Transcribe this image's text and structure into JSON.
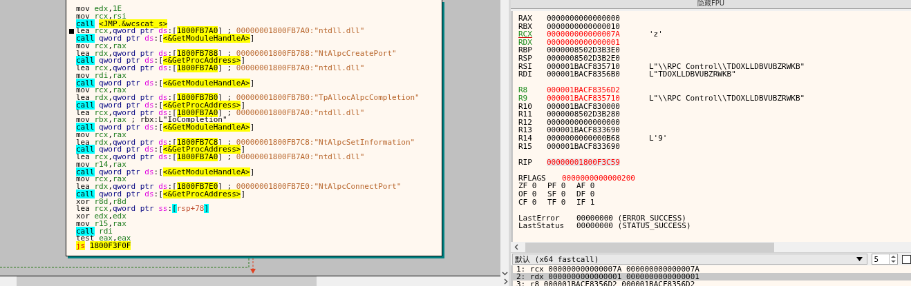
{
  "disassembly": {
    "lines": [
      {
        "marker": false,
        "tokens": [
          {
            "kind": "op",
            "text": "mov "
          },
          {
            "kind": "reg",
            "text": "edx"
          },
          {
            "kind": "punct",
            "text": ","
          },
          {
            "kind": "num",
            "text": "1E"
          }
        ]
      },
      {
        "marker": false,
        "tokens": [
          {
            "kind": "op",
            "text": "mov "
          },
          {
            "kind": "reg",
            "text": "rcx"
          },
          {
            "kind": "punct",
            "text": ","
          },
          {
            "kind": "reg",
            "text": "rsi"
          }
        ]
      },
      {
        "marker": false,
        "tokens": [
          {
            "kind": "call",
            "text": "call"
          },
          {
            "kind": "sym",
            "text": "<JMP.&wcscat_s>"
          }
        ]
      },
      {
        "marker": true,
        "tokens": [
          {
            "kind": "op",
            "text": "lea "
          },
          {
            "kind": "reg",
            "text": "rcx"
          },
          {
            "kind": "punct",
            "text": ","
          },
          {
            "kind": "kw",
            "text": "qword ptr "
          },
          {
            "kind": "seg",
            "text": "ds"
          },
          {
            "kind": "punct",
            "text": ":["
          },
          {
            "kind": "addr",
            "text": "1800FB7A0"
          },
          {
            "kind": "punct",
            "text": "] ; "
          },
          {
            "kind": "comment",
            "text": "00000001800FB7A0:\"ntdll.dll\""
          }
        ]
      },
      {
        "marker": false,
        "tokens": [
          {
            "kind": "call",
            "text": "call"
          },
          {
            "kind": "kw",
            "text": "qword ptr "
          },
          {
            "kind": "seg",
            "text": "ds"
          },
          {
            "kind": "punct",
            "text": ":["
          },
          {
            "kind": "sym",
            "text": "<&GetModuleHandleA>"
          },
          {
            "kind": "punct",
            "text": "]"
          }
        ]
      },
      {
        "marker": false,
        "tokens": [
          {
            "kind": "op",
            "text": "mov "
          },
          {
            "kind": "reg",
            "text": "rcx"
          },
          {
            "kind": "punct",
            "text": ","
          },
          {
            "kind": "reg",
            "text": "rax"
          }
        ]
      },
      {
        "marker": false,
        "tokens": [
          {
            "kind": "op",
            "text": "lea "
          },
          {
            "kind": "reg",
            "text": "rdx"
          },
          {
            "kind": "punct",
            "text": ","
          },
          {
            "kind": "kw",
            "text": "qword ptr "
          },
          {
            "kind": "seg",
            "text": "ds"
          },
          {
            "kind": "punct",
            "text": ":["
          },
          {
            "kind": "addr",
            "text": "1800FB788"
          },
          {
            "kind": "punct",
            "text": "] ; "
          },
          {
            "kind": "comment",
            "text": "00000001800FB788:\"NtAlpcCreatePort\""
          }
        ]
      },
      {
        "marker": false,
        "tokens": [
          {
            "kind": "call",
            "text": "call"
          },
          {
            "kind": "kw",
            "text": "qword ptr "
          },
          {
            "kind": "seg",
            "text": "ds"
          },
          {
            "kind": "punct",
            "text": ":["
          },
          {
            "kind": "sym",
            "text": "<&GetProcAddress>"
          },
          {
            "kind": "punct",
            "text": "]"
          }
        ]
      },
      {
        "marker": false,
        "tokens": [
          {
            "kind": "op",
            "text": "lea "
          },
          {
            "kind": "reg",
            "text": "rcx"
          },
          {
            "kind": "punct",
            "text": ","
          },
          {
            "kind": "kw",
            "text": "qword ptr "
          },
          {
            "kind": "seg",
            "text": "ds"
          },
          {
            "kind": "punct",
            "text": ":["
          },
          {
            "kind": "addr",
            "text": "1800FB7A0"
          },
          {
            "kind": "punct",
            "text": "] ; "
          },
          {
            "kind": "comment",
            "text": "00000001800FB7A0:\"ntdll.dll\""
          }
        ]
      },
      {
        "marker": false,
        "tokens": [
          {
            "kind": "op",
            "text": "mov "
          },
          {
            "kind": "reg",
            "text": "rdi"
          },
          {
            "kind": "punct",
            "text": ","
          },
          {
            "kind": "reg",
            "text": "rax"
          }
        ]
      },
      {
        "marker": false,
        "tokens": [
          {
            "kind": "call",
            "text": "call"
          },
          {
            "kind": "kw",
            "text": "qword ptr "
          },
          {
            "kind": "seg",
            "text": "ds"
          },
          {
            "kind": "punct",
            "text": ":["
          },
          {
            "kind": "sym",
            "text": "<&GetModuleHandleA>"
          },
          {
            "kind": "punct",
            "text": "]"
          }
        ]
      },
      {
        "marker": false,
        "tokens": [
          {
            "kind": "op",
            "text": "mov "
          },
          {
            "kind": "reg",
            "text": "rcx"
          },
          {
            "kind": "punct",
            "text": ","
          },
          {
            "kind": "reg",
            "text": "rax"
          }
        ]
      },
      {
        "marker": false,
        "tokens": [
          {
            "kind": "op",
            "text": "lea "
          },
          {
            "kind": "reg",
            "text": "rdx"
          },
          {
            "kind": "punct",
            "text": ","
          },
          {
            "kind": "kw",
            "text": "qword ptr "
          },
          {
            "kind": "seg",
            "text": "ds"
          },
          {
            "kind": "punct",
            "text": ":["
          },
          {
            "kind": "addr",
            "text": "1800FB7B0"
          },
          {
            "kind": "punct",
            "text": "] ; "
          },
          {
            "kind": "comment",
            "text": "00000001800FB7B0:\"TpAllocAlpcCompletion\""
          }
        ]
      },
      {
        "marker": false,
        "tokens": [
          {
            "kind": "call",
            "text": "call"
          },
          {
            "kind": "kw",
            "text": "qword ptr "
          },
          {
            "kind": "seg",
            "text": "ds"
          },
          {
            "kind": "punct",
            "text": ":["
          },
          {
            "kind": "sym",
            "text": "<&GetProcAddress>"
          },
          {
            "kind": "punct",
            "text": "]"
          }
        ]
      },
      {
        "marker": false,
        "tokens": [
          {
            "kind": "op",
            "text": "lea "
          },
          {
            "kind": "reg",
            "text": "rcx"
          },
          {
            "kind": "punct",
            "text": ","
          },
          {
            "kind": "kw",
            "text": "qword ptr "
          },
          {
            "kind": "seg",
            "text": "ds"
          },
          {
            "kind": "punct",
            "text": ":["
          },
          {
            "kind": "addr",
            "text": "1800FB7A0"
          },
          {
            "kind": "punct",
            "text": "] ; "
          },
          {
            "kind": "comment",
            "text": "00000001800FB7A0:\"ntdll.dll\""
          }
        ]
      },
      {
        "marker": false,
        "tokens": [
          {
            "kind": "op",
            "text": "mov "
          },
          {
            "kind": "reg",
            "text": "rbx"
          },
          {
            "kind": "punct",
            "text": ","
          },
          {
            "kind": "reg",
            "text": "rax"
          },
          {
            "kind": "punct",
            "text": " ; rbx:L\"IoCompletion\""
          }
        ]
      },
      {
        "marker": false,
        "tokens": [
          {
            "kind": "call",
            "text": "call"
          },
          {
            "kind": "kw",
            "text": "qword ptr "
          },
          {
            "kind": "seg",
            "text": "ds"
          },
          {
            "kind": "punct",
            "text": ":["
          },
          {
            "kind": "sym",
            "text": "<&GetModuleHandleA>"
          },
          {
            "kind": "punct",
            "text": "]"
          }
        ]
      },
      {
        "marker": false,
        "tokens": [
          {
            "kind": "op",
            "text": "mov "
          },
          {
            "kind": "reg",
            "text": "rcx"
          },
          {
            "kind": "punct",
            "text": ","
          },
          {
            "kind": "reg",
            "text": "rax"
          }
        ]
      },
      {
        "marker": false,
        "tokens": [
          {
            "kind": "op",
            "text": "lea "
          },
          {
            "kind": "reg",
            "text": "rdx"
          },
          {
            "kind": "punct",
            "text": ","
          },
          {
            "kind": "kw",
            "text": "qword ptr "
          },
          {
            "kind": "seg",
            "text": "ds"
          },
          {
            "kind": "punct",
            "text": ":["
          },
          {
            "kind": "addr",
            "text": "1800FB7C8"
          },
          {
            "kind": "punct",
            "text": "] ; "
          },
          {
            "kind": "comment",
            "text": "00000001800FB7C8:\"NtAlpcSetInformation\""
          }
        ]
      },
      {
        "marker": false,
        "tokens": [
          {
            "kind": "call",
            "text": "call"
          },
          {
            "kind": "kw",
            "text": "qword ptr "
          },
          {
            "kind": "seg",
            "text": "ds"
          },
          {
            "kind": "punct",
            "text": ":["
          },
          {
            "kind": "sym",
            "text": "<&GetProcAddress>"
          },
          {
            "kind": "punct",
            "text": "]"
          }
        ]
      },
      {
        "marker": false,
        "tokens": [
          {
            "kind": "op",
            "text": "lea "
          },
          {
            "kind": "reg",
            "text": "rcx"
          },
          {
            "kind": "punct",
            "text": ","
          },
          {
            "kind": "kw",
            "text": "qword ptr "
          },
          {
            "kind": "seg",
            "text": "ds"
          },
          {
            "kind": "punct",
            "text": ":["
          },
          {
            "kind": "addr",
            "text": "1800FB7A0"
          },
          {
            "kind": "punct",
            "text": "] ; "
          },
          {
            "kind": "comment",
            "text": "00000001800FB7A0:\"ntdll.dll\""
          }
        ]
      },
      {
        "marker": false,
        "tokens": [
          {
            "kind": "op",
            "text": "mov "
          },
          {
            "kind": "reg",
            "text": "r14"
          },
          {
            "kind": "punct",
            "text": ","
          },
          {
            "kind": "reg",
            "text": "rax"
          }
        ]
      },
      {
        "marker": false,
        "tokens": [
          {
            "kind": "call",
            "text": "call"
          },
          {
            "kind": "kw",
            "text": "qword ptr "
          },
          {
            "kind": "seg",
            "text": "ds"
          },
          {
            "kind": "punct",
            "text": ":["
          },
          {
            "kind": "sym",
            "text": "<&GetModuleHandleA>"
          },
          {
            "kind": "punct",
            "text": "]"
          }
        ]
      },
      {
        "marker": false,
        "tokens": [
          {
            "kind": "op",
            "text": "mov "
          },
          {
            "kind": "reg",
            "text": "rcx"
          },
          {
            "kind": "punct",
            "text": ","
          },
          {
            "kind": "reg",
            "text": "rax"
          }
        ]
      },
      {
        "marker": false,
        "tokens": [
          {
            "kind": "op",
            "text": "lea "
          },
          {
            "kind": "reg",
            "text": "rdx"
          },
          {
            "kind": "punct",
            "text": ","
          },
          {
            "kind": "kw",
            "text": "qword ptr "
          },
          {
            "kind": "seg",
            "text": "ds"
          },
          {
            "kind": "punct",
            "text": ":["
          },
          {
            "kind": "addr",
            "text": "1800FB7E0"
          },
          {
            "kind": "punct",
            "text": "] ; "
          },
          {
            "kind": "comment",
            "text": "00000001800FB7E0:\"NtAlpcConnectPort\""
          }
        ]
      },
      {
        "marker": false,
        "tokens": [
          {
            "kind": "call",
            "text": "call"
          },
          {
            "kind": "kw",
            "text": "qword ptr "
          },
          {
            "kind": "seg",
            "text": "ds"
          },
          {
            "kind": "punct",
            "text": ":["
          },
          {
            "kind": "sym",
            "text": "<&GetProcAddress>"
          },
          {
            "kind": "punct",
            "text": "]"
          }
        ]
      },
      {
        "marker": false,
        "tokens": [
          {
            "kind": "op",
            "text": "xor "
          },
          {
            "kind": "reg",
            "text": "r8d"
          },
          {
            "kind": "punct",
            "text": ","
          },
          {
            "kind": "reg",
            "text": "r8d"
          }
        ]
      },
      {
        "marker": false,
        "tokens": [
          {
            "kind": "op",
            "text": "lea "
          },
          {
            "kind": "reg",
            "text": "rcx"
          },
          {
            "kind": "punct",
            "text": ","
          },
          {
            "kind": "kw",
            "text": "qword ptr "
          },
          {
            "kind": "seg",
            "text": "ss"
          },
          {
            "kind": "punct",
            "text": ":"
          },
          {
            "kind": "bracket",
            "text": "["
          },
          {
            "kind": "memref",
            "text": "rsp+78"
          },
          {
            "kind": "bracket",
            "text": "]"
          }
        ]
      },
      {
        "marker": false,
        "tokens": [
          {
            "kind": "op",
            "text": "xor "
          },
          {
            "kind": "reg",
            "text": "edx"
          },
          {
            "kind": "punct",
            "text": ","
          },
          {
            "kind": "reg",
            "text": "edx"
          }
        ]
      },
      {
        "marker": false,
        "tokens": [
          {
            "kind": "op",
            "text": "mov "
          },
          {
            "kind": "reg",
            "text": "r15"
          },
          {
            "kind": "punct",
            "text": ","
          },
          {
            "kind": "reg",
            "text": "rax"
          }
        ]
      },
      {
        "marker": false,
        "tokens": [
          {
            "kind": "call",
            "text": "call"
          },
          {
            "kind": "reg",
            "text": "rdi"
          }
        ]
      },
      {
        "marker": false,
        "tokens": [
          {
            "kind": "op",
            "text": "test "
          },
          {
            "kind": "reg",
            "text": "eax"
          },
          {
            "kind": "punct",
            "text": ","
          },
          {
            "kind": "reg",
            "text": "eax"
          }
        ]
      },
      {
        "marker": false,
        "tokens": [
          {
            "kind": "jump",
            "text": "js"
          },
          {
            "kind": "addr",
            "text": "1800F3F0F"
          }
        ]
      }
    ]
  },
  "registers_panel": {
    "title": "隐藏FPU",
    "groups": [
      [
        {
          "name": "RAX",
          "value": "0000000000000000",
          "modified": false,
          "changed": false,
          "selected": false
        },
        {
          "name": "RBX",
          "value": "0000000000000010",
          "modified": false,
          "changed": false,
          "selected": false
        },
        {
          "name": "RCX",
          "value": "000000000000007A",
          "comment": "'z'",
          "modified": true,
          "changed": true,
          "selected": true
        },
        {
          "name": "RDX",
          "value": "0000000000000001",
          "modified": true,
          "changed": true,
          "selected": false
        },
        {
          "name": "RBP",
          "value": "0000008502D3B3E0",
          "modified": false,
          "changed": false,
          "selected": false
        },
        {
          "name": "RSP",
          "value": "0000008502D3B2E0",
          "modified": false,
          "changed": false,
          "selected": false
        },
        {
          "name": "RSI",
          "value": "000001BACF835710",
          "comment": "L\"\\\\RPC Control\\\\TDOXLLDBVUBZRWKB\"",
          "modified": false,
          "changed": false,
          "selected": false
        },
        {
          "name": "RDI",
          "value": "000001BACF8356B0",
          "comment": "L\"TDOXLLDBVUBZRWKB\"",
          "modified": false,
          "changed": false,
          "selected": false
        }
      ],
      [
        {
          "name": "R8",
          "value": "000001BACF8356D2",
          "modified": true,
          "changed": true,
          "selected": false
        },
        {
          "name": "R9",
          "value": "000001BACF835710",
          "comment": "L\"\\\\RPC Control\\\\TDOXLLDBVUBZRWKB\"",
          "modified": true,
          "changed": true,
          "selected": false
        },
        {
          "name": "R10",
          "value": "000001BACF830000",
          "modified": false,
          "changed": false,
          "selected": false
        },
        {
          "name": "R11",
          "value": "0000008502D3B280",
          "modified": false,
          "changed": false,
          "selected": false
        },
        {
          "name": "R12",
          "value": "0000000000000000",
          "modified": false,
          "changed": false,
          "selected": false
        },
        {
          "name": "R13",
          "value": "000001BACF833690",
          "modified": false,
          "changed": false,
          "selected": false
        },
        {
          "name": "R14",
          "value": "0000000000000B68",
          "comment": "L'9'",
          "modified": false,
          "changed": false,
          "selected": false
        },
        {
          "name": "R15",
          "value": "000001BACF833690",
          "modified": false,
          "changed": false,
          "selected": false
        }
      ],
      [
        {
          "name": "RIP",
          "value": "00000001800F3C59",
          "modified": false,
          "changed": true,
          "selected": false
        }
      ]
    ],
    "rflags": {
      "name": "RFLAGS",
      "value": "0000000000000200",
      "changed": true
    },
    "flags": [
      [
        {
          "name": "ZF",
          "value": "0"
        },
        {
          "name": "PF",
          "value": "0"
        },
        {
          "name": "AF",
          "value": "0"
        }
      ],
      [
        {
          "name": "OF",
          "value": "0"
        },
        {
          "name": "SF",
          "value": "0"
        },
        {
          "name": "DF",
          "value": "0"
        }
      ],
      [
        {
          "name": "CF",
          "value": "0"
        },
        {
          "name": "TF",
          "value": "0"
        },
        {
          "name": "IF",
          "value": "1"
        }
      ]
    ],
    "status": [
      {
        "name": "LastError",
        "value": "00000000",
        "comment": "(ERROR_SUCCESS)"
      },
      {
        "name": "LastStatus",
        "value": "00000000",
        "comment": "(STATUS_SUCCESS)"
      }
    ]
  },
  "call_convention": {
    "value": "默认 (x64 fastcall)",
    "count": "5",
    "checked": false
  },
  "arguments": [
    {
      "text": "1: rcx 000000000000007A 000000000000007A",
      "selected": false
    },
    {
      "text": "2: rdx 0000000000000001 0000000000000001",
      "selected": true
    },
    {
      "text": "3: r8 000001BACF8356D2 000001BACF8356D2",
      "selected": false
    }
  ]
}
